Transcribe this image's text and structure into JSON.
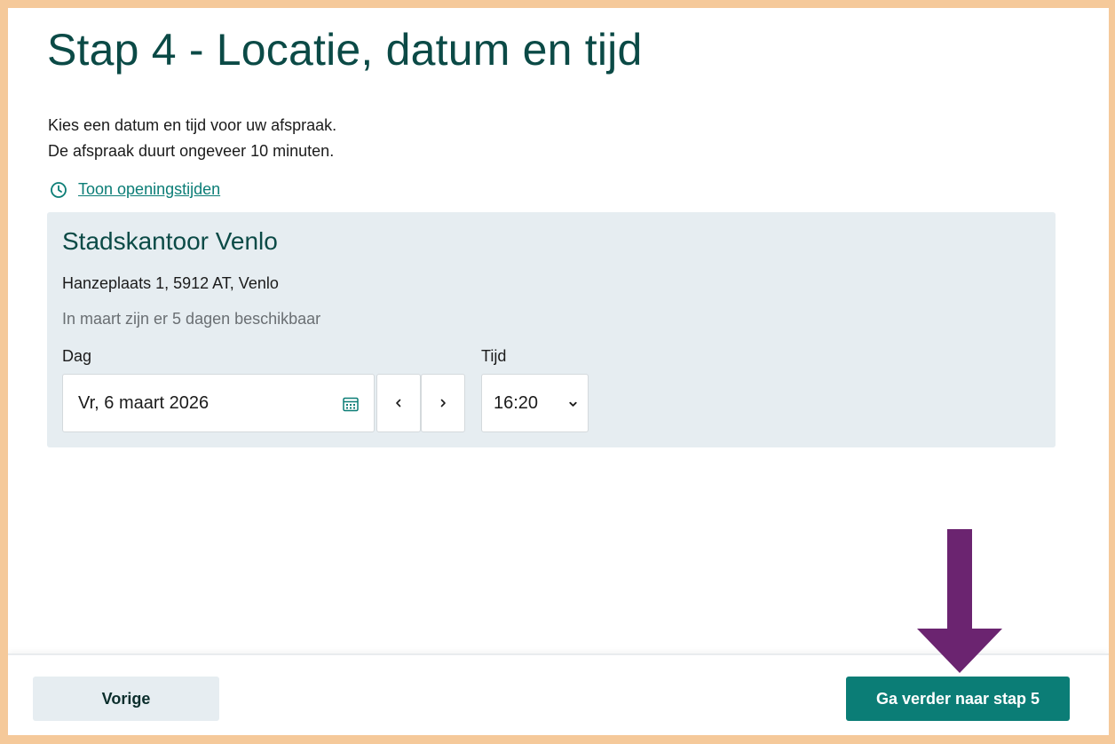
{
  "page": {
    "title": "Stap 4 - Locatie, datum en tijd",
    "intro_line_1": "Kies een datum en tijd voor uw afspraak.",
    "intro_line_2": "De afspraak duurt ongeveer 10 minuten.",
    "opening_hours_link": "Toon openingstijden"
  },
  "location": {
    "name": "Stadskantoor Venlo",
    "address": "Hanzeplaats 1, 5912 AT, Venlo",
    "availability": "In maart zijn er 5 dagen beschikbaar",
    "day_label": "Dag",
    "day_value": "Vr, 6 maart 2026",
    "time_label": "Tijd",
    "time_value": "16:20",
    "prev_day_symbol": "‹",
    "next_day_symbol": "›"
  },
  "footer": {
    "prev_label": "Vorige",
    "next_label": "Ga verder naar stap 5"
  },
  "colors": {
    "frame_border": "#f5c99a",
    "primary": "#0b7d76",
    "heading": "#0b4a46",
    "card_background": "#e6edf1",
    "arrow": "#6b2470"
  },
  "icons": {
    "opening_hours": "clock-icon",
    "date_picker": "calendar-icon",
    "prev_day": "chevron-left-icon",
    "next_day": "chevron-right-icon",
    "time_select": "chevron-down-icon",
    "annotation": "arrow-down-icon"
  }
}
